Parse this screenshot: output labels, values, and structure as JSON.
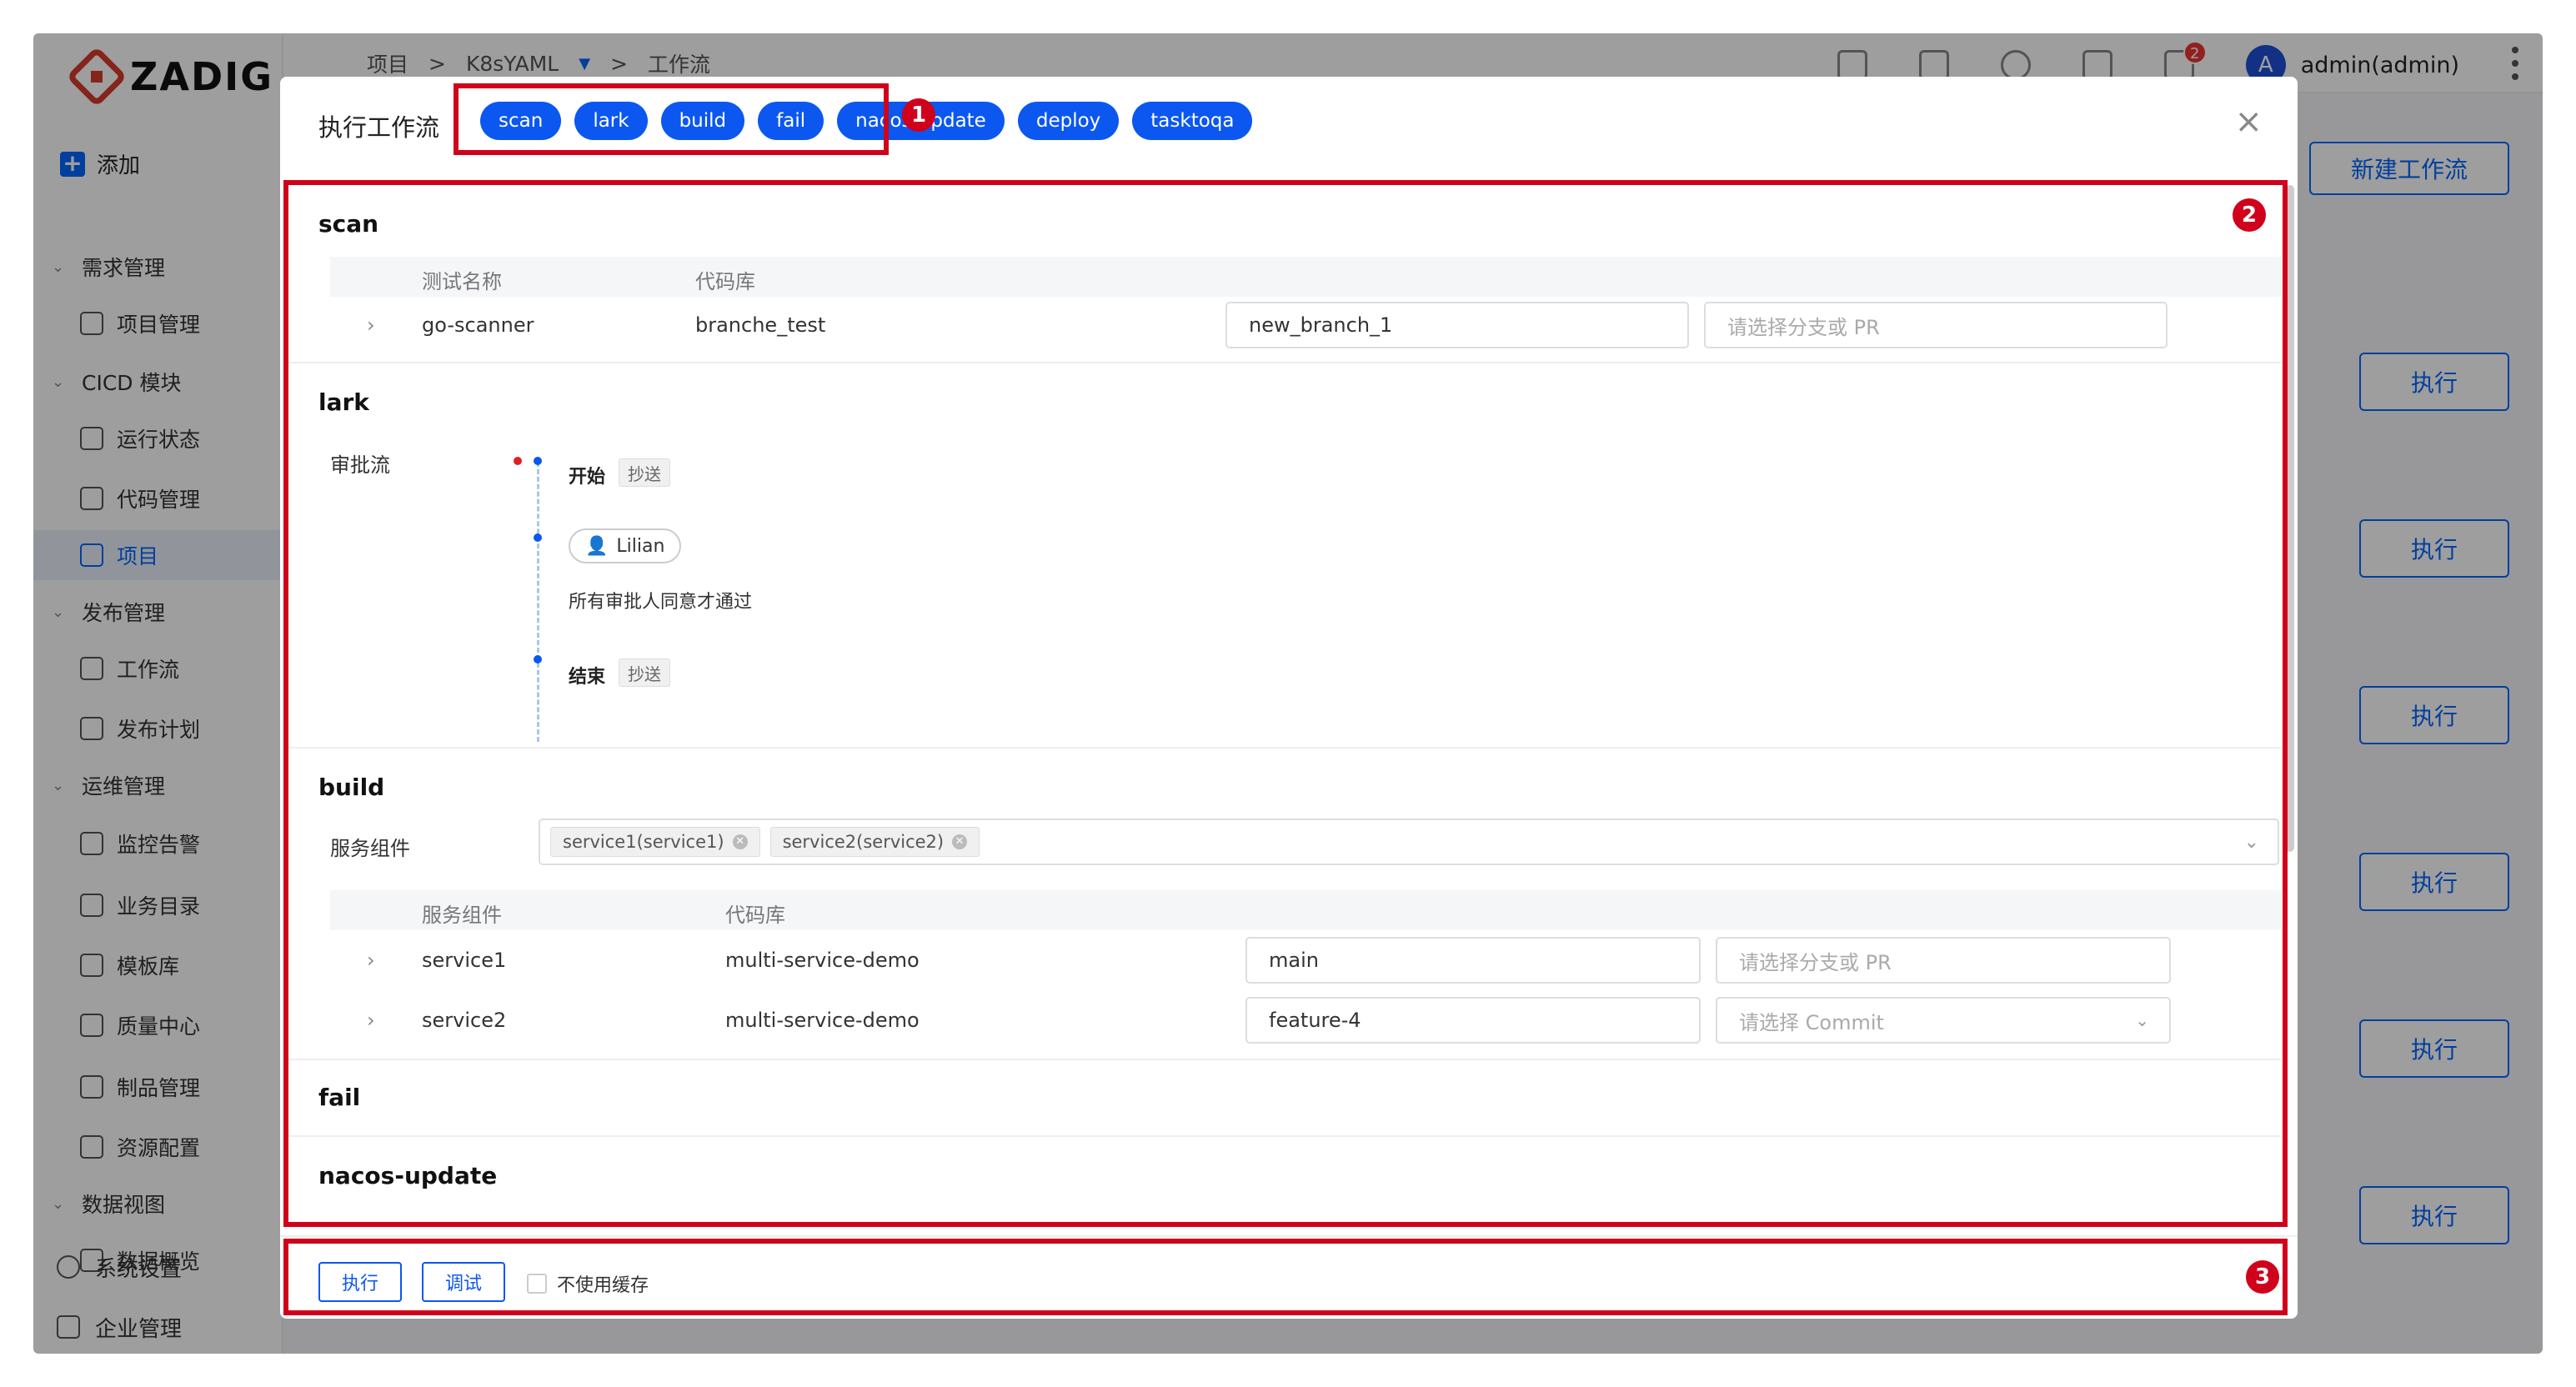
{
  "app": {
    "logo": "ZADIG"
  },
  "sidebar": {
    "add_label": "添加",
    "groups": [
      {
        "label": "需求管理",
        "items": [
          "项目管理"
        ]
      },
      {
        "label": "CICD 模块",
        "items": [
          "运行状态",
          "代码管理",
          "项目"
        ]
      },
      {
        "label": "发布管理",
        "items": [
          "工作流",
          "发布计划"
        ]
      },
      {
        "label": "运维管理",
        "items": [
          "监控告警",
          "业务目录",
          "模板库",
          "质量中心",
          "制品管理",
          "资源配置"
        ]
      },
      {
        "label": "数据视图",
        "items": [
          "数据概览"
        ]
      }
    ],
    "bottom": [
      "系统设置",
      "企业管理"
    ]
  },
  "topbar": {
    "breadcrumb": [
      "项目",
      ">",
      "K8sYAML",
      ">",
      "工作流"
    ],
    "notification_count": "2",
    "avatar_letter": "A",
    "user": "admin(admin)"
  },
  "background": {
    "new_workflow_label": "新建工作流",
    "run_label": "执行"
  },
  "modal": {
    "title": "执行工作流",
    "stages": [
      "scan",
      "lark",
      "build",
      "fail",
      "nacos-update",
      "deploy",
      "tasktoqa"
    ],
    "close_glyph": "×",
    "callouts": [
      "1",
      "2",
      "3"
    ],
    "scan": {
      "title": "scan",
      "headers": [
        "测试名称",
        "代码库"
      ],
      "row": {
        "name": "go-scanner",
        "repo": "branche_test",
        "branch": "new_branch_1",
        "pr_placeholder": "请选择分支或 PR"
      }
    },
    "lark": {
      "title": "lark",
      "label": "审批流",
      "start": "开始",
      "cc": "抄送",
      "approver": "Lilian",
      "rule": "所有审批人同意才通过",
      "end": "结束"
    },
    "build": {
      "title": "build",
      "service_label": "服务组件",
      "selected": [
        "service1(service1)",
        "service2(service2)"
      ],
      "headers": [
        "服务组件",
        "代码库"
      ],
      "rows": [
        {
          "service": "service1",
          "repo": "multi-service-demo",
          "branch": "main",
          "placeholder": "请选择分支或 PR"
        },
        {
          "service": "service2",
          "repo": "multi-service-demo",
          "branch": "feature-4",
          "placeholder": "请选择 Commit"
        }
      ]
    },
    "fail": {
      "title": "fail"
    },
    "nacos": {
      "title": "nacos-update"
    },
    "footer": {
      "run": "执行",
      "debug": "调试",
      "no_cache": "不使用缓存"
    }
  }
}
